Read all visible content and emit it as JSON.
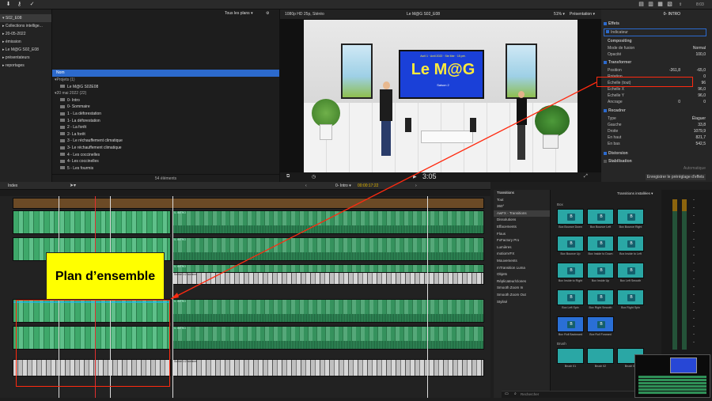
{
  "toolbar": {
    "right_time": "8:03"
  },
  "library": {
    "items": [
      {
        "label": "S02_E08",
        "selected": true
      },
      {
        "label": "Collections intellige...",
        "selected": false
      },
      {
        "label": "20-05-2022",
        "selected": false
      },
      {
        "label": "émission",
        "selected": false
      },
      {
        "label": "Le M@G S02_E08",
        "selected": false
      },
      {
        "label": "présentateurs",
        "selected": false
      },
      {
        "label": "reportages",
        "selected": false
      }
    ]
  },
  "browser": {
    "filter": "Tous les plans",
    "column_name": "Nom",
    "projects_header": "Projets",
    "projects_count": "(1)",
    "project_item": "Le M@G S02E08",
    "date_header": "20 mai 2022",
    "date_count": "(22)",
    "clips": [
      "0- Intro",
      "0- Sommaire",
      "1 - La déforestation",
      "1- La déforestation",
      "2 - La forêt",
      "2- La forêt",
      "3 - Le réchauffement climatique",
      "3- Le réchauffement climatique",
      "4 - Les coccinelles",
      "4- Les coccinelles",
      "5 - Les fourmis"
    ],
    "footer": "54 éléments"
  },
  "viewer": {
    "format": "1080p HD 25p, Stéréo",
    "project": "Le M@G S02_E08",
    "zoom": "51%",
    "view_menu": "Présentation",
    "timecode": "3:05",
    "on_screen_title": "Le M@G",
    "on_screen_subtitle": "Saison 2",
    "marquee": "Avril 1 · Avril 2022 · Ste Mer · 15 pré."
  },
  "inspector": {
    "clip_name": "0- INTRO",
    "sections": {
      "effets": "Effets",
      "indicateur": "Indicateur",
      "compositing": "Compositing",
      "transformer": "Transformer",
      "recadrer": "Recadrer",
      "distorsion": "Distorsion",
      "stabilisation": "Stabilisation"
    },
    "rows": {
      "mode_fusion": {
        "label": "Mode de fusion",
        "value": "Normal"
      },
      "opacite": {
        "label": "Opacité",
        "value": "100,0"
      },
      "position": {
        "label": "Position",
        "x": "-261,8",
        "y": "-65,0"
      },
      "rotation": {
        "label": "Rotation",
        "value": "0"
      },
      "echelle_tout": {
        "label": "Échelle (tout)",
        "value": "96"
      },
      "echelle_x": {
        "label": "Échelle X",
        "value": "96,0"
      },
      "echelle_y": {
        "label": "Échelle Y",
        "value": "96,0"
      },
      "ancrage": {
        "label": "Ancrage",
        "x": "0",
        "y": "0"
      },
      "type": {
        "label": "Type",
        "value": "Élaguer"
      },
      "gauche": {
        "label": "Gauche",
        "value": "33,8"
      },
      "droite": {
        "label": "Droite",
        "value": "1079,9"
      },
      "en_haut": {
        "label": "En haut",
        "value": "821,7"
      },
      "en_bas": {
        "label": "En bas",
        "value": "542,5"
      }
    },
    "stab_value": "Automatique",
    "save_preset": "Enregistrer le préréglage d'effets"
  },
  "timeline": {
    "index_label": "Index",
    "clip_title": "0- Intro",
    "timecode": "00:00:17:22",
    "clip_tags": [
      "0- INTRO",
      "0- INTRO",
      "0- INTRO",
      "Scène 1/2 nombre",
      "0- INTRO",
      "0- INTRO",
      "Scène 1/2 nombre"
    ]
  },
  "transitions": {
    "header": "Transitions",
    "installed": "Transitions installées",
    "categories": [
      "Tout",
      "360°",
      "AwFX - Transitions",
      "Dissolutions",
      "Effacements",
      "Flous",
      "FxFactory Pro",
      "Lumières",
      "motionVFX",
      "Mouvements",
      "mTransition Luma",
      "Objets",
      "Réplicateur/clones",
      "Smooth Zoom In",
      "Smooth Zoom Out",
      "Stylisé"
    ],
    "selected_index": 2,
    "group_box": "Box",
    "group_brush": "Brush",
    "thumbs": [
      "Box Bounce Down",
      "Box Bounce Left",
      "Box Bounce Right",
      "Box Bounce Up",
      "Box Inside to Down",
      "Box Inside to Left",
      "Box Inside to Right",
      "Box Inside Up",
      "Box Left Smooth",
      "Box Left Spin",
      "Box Right Smooth",
      "Box Right Spin",
      "Box Roll Backward",
      "Box Roll Forward"
    ],
    "brush_thumbs": [
      "Brush 01",
      "Brush 02",
      "Brush 03"
    ],
    "search_placeholder": "Rechercher"
  },
  "overlay": {
    "label": "Plan d’ensemble"
  },
  "colors": {
    "accent": "#2c6acd",
    "highlight": "#ff2a10",
    "label_bg": "#ffff00"
  }
}
